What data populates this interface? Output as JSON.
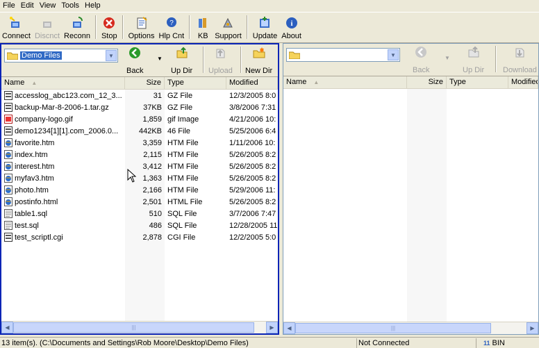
{
  "menu": [
    "File",
    "Edit",
    "View",
    "Tools",
    "Help"
  ],
  "toolbar": {
    "connect": "Connect",
    "disconnect": "Discnct",
    "reconnect": "Reconn",
    "stop": "Stop",
    "options": "Options",
    "help_contents": "Hlp Cnt",
    "kb": "KB",
    "support": "Support",
    "update": "Update",
    "about": "About"
  },
  "left": {
    "folder": "Demo Files",
    "back": "Back",
    "up_dir": "Up Dir",
    "upload": "Upload",
    "new_dir": "New Dir",
    "columns": {
      "name": "Name",
      "size": "Size",
      "type": "Type",
      "modified": "Modified"
    },
    "files": [
      {
        "name": "accesslog_abc123.com_12_3...",
        "size": "31",
        "type": "GZ File",
        "modified": "12/3/2005 8:0",
        "icon": "archive"
      },
      {
        "name": "backup-Mar-8-2006-1.tar.gz",
        "size": "37KB",
        "type": "GZ File",
        "modified": "3/8/2006 7:31",
        "icon": "archive"
      },
      {
        "name": "company-logo.gif",
        "size": "1,859",
        "type": "gif Image",
        "modified": "4/21/2006 10:",
        "icon": "image"
      },
      {
        "name": "demo1234[1][1].com_2006.0...",
        "size": "442KB",
        "type": "46 File",
        "modified": "5/25/2006 6:4",
        "icon": "archive"
      },
      {
        "name": "favorite.htm",
        "size": "3,359",
        "type": "HTM File",
        "modified": "1/11/2006 10:",
        "icon": "web"
      },
      {
        "name": "index.htm",
        "size": "2,115",
        "type": "HTM File",
        "modified": "5/26/2005 8:2",
        "icon": "web"
      },
      {
        "name": "interest.htm",
        "size": "3,412",
        "type": "HTM File",
        "modified": "5/26/2005 8:2",
        "icon": "web"
      },
      {
        "name": "myfav3.htm",
        "size": "1,363",
        "type": "HTM File",
        "modified": "5/26/2005 8:2",
        "icon": "web"
      },
      {
        "name": "photo.htm",
        "size": "2,166",
        "type": "HTM File",
        "modified": "5/29/2006 11:",
        "icon": "web"
      },
      {
        "name": "postinfo.html",
        "size": "2,501",
        "type": "HTML File",
        "modified": "5/26/2005 8:2",
        "icon": "web"
      },
      {
        "name": "table1.sql",
        "size": "510",
        "type": "SQL File",
        "modified": "3/7/2006 7:47",
        "icon": "text"
      },
      {
        "name": "test.sql",
        "size": "486",
        "type": "SQL File",
        "modified": "12/28/2005 11",
        "icon": "text"
      },
      {
        "name": "test_scriptl.cgi",
        "size": "2,878",
        "type": "CGI File",
        "modified": "12/2/2005 5:0",
        "icon": "archive"
      }
    ]
  },
  "right": {
    "folder": "",
    "back": "Back",
    "up_dir": "Up Dir",
    "download": "Download",
    "columns": {
      "name": "Name",
      "size": "Size",
      "type": "Type",
      "modified": "Modified"
    }
  },
  "status": {
    "items": "13 item(s).",
    "path": "(C:\\Documents and Settings\\Rob Moore\\Desktop\\Demo Files)",
    "connection": "Not Connected",
    "mode": "BIN"
  }
}
